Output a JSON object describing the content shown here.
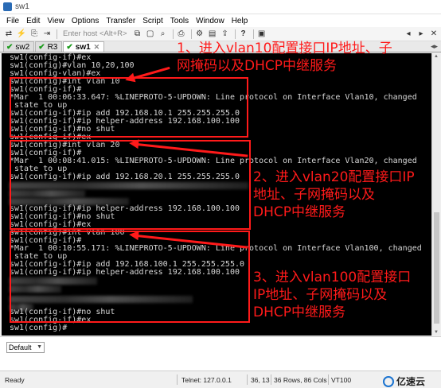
{
  "window": {
    "title": "sw1"
  },
  "menu": [
    "File",
    "Edit",
    "View",
    "Options",
    "Transfer",
    "Script",
    "Tools",
    "Window",
    "Help"
  ],
  "toolbar": {
    "host_placeholder": "Enter host <Alt+R>",
    "help": "?"
  },
  "tabs": [
    {
      "label": "sw2",
      "active": false
    },
    {
      "label": "R3",
      "active": false
    },
    {
      "label": "sw1",
      "active": true
    }
  ],
  "terminal": {
    "lines": [
      "sw1(config-if)#ex",
      "sw1(config)#vlan 10,20,100",
      "sw1(config-vlan)#ex",
      "sw1(config)#int vlan 10",
      "sw1(config-if)#",
      "*Mar  1 00:06:33.647: %LINEPROTO-5-UPDOWN: Line protocol on Interface Vlan10, changed",
      " state to up",
      "sw1(config-if)#ip add 192.168.10.1 255.255.255.0",
      "sw1(config-if)#ip helper-address 192.168.100.100",
      "sw1(config-if)#no shut",
      "sw1(config-if)#ex",
      "sw1(config)#int vlan 20",
      "sw1(config-if)#",
      "*Mar  1 00:08:41.015: %LINEPROTO-5-UPDOWN: Line protocol on Interface Vlan20, changed",
      " state to up",
      "sw1(config-if)#ip add 192.168.20.1 255.255.255.0",
      "",
      "",
      "",
      "sw1(config-if)#ip helper-address 192.168.100.100",
      "sw1(config-if)#no shut",
      "sw1(config-if)#ex",
      "sw1(config)#int vlan 100",
      "sw1(config-if)#",
      "*Mar  1 00:10:55.171: %LINEPROTO-5-UPDOWN: Line protocol on Interface Vlan100, changed",
      " state to up",
      "sw1(config-if)#ip add 192.168.100.1 255.255.255.0",
      "sw1(config-if)#ip helper-address 192.168.100.100",
      "",
      "",
      "",
      "",
      "sw1(config-if)#no shut",
      "sw1(config-if)#ex",
      "sw1(config)#"
    ]
  },
  "annotations": [
    "1、进入vlan10配置接口IP地址、子\n网掩码以及DHCP中继服务",
    "2、进入vlan20配置接口IP\n地址、子网掩码以及\nDHCP中继服务",
    "3、进入vlan100配置接口\nIP地址、子网掩码以及\nDHCP中继服务"
  ],
  "bottom": {
    "session_select": "Default"
  },
  "status": {
    "ready": "Ready",
    "telnet": "Telnet: 127.0.0.1",
    "cursor": "36, 13",
    "size": "36 Rows, 86 Cols",
    "emulation": "VT100",
    "brand": "亿速云"
  },
  "colors": {
    "annotation": "#ff1a1a",
    "terminal_bg": "#000000",
    "terminal_fg": "#d8d8d8"
  }
}
